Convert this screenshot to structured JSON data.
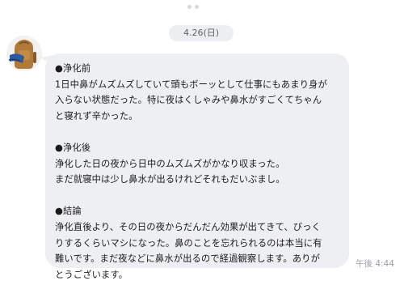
{
  "date_separator": "4.26(日)",
  "message": {
    "sections": [
      {
        "lines": [
          "●浄化前",
          "1日中鼻がムズムズしていて頭もボーッとして仕事にもあまり身が",
          "入らない状態だった。特に夜はくしゃみや鼻水がすごくてちゃん",
          "と寝れず辛かった。"
        ]
      },
      {
        "lines": [
          "●浄化後",
          "浄化した日の夜から日中のムズムズがかなり収まった。",
          "まだ就寝中は少し鼻水が出るけれどそれもだいぶまし。"
        ]
      },
      {
        "lines": [
          "●結論",
          "浄化直後より、その日の夜からだんだん効果が出てきて、びっく",
          "りするくらいマシになった。鼻のことを忘れられるのは本当に有",
          "難いです。まだ夜などに鼻水が出るので経過観察します。ありが",
          "とうございます。"
        ]
      }
    ],
    "time": "午後 4:44"
  },
  "colors": {
    "bubble_bg": "#eeeff2",
    "date_pill_bg": "#eceef1",
    "time_text": "#9a9ea5"
  },
  "icons": {
    "avatar": "backpack-avatar"
  }
}
